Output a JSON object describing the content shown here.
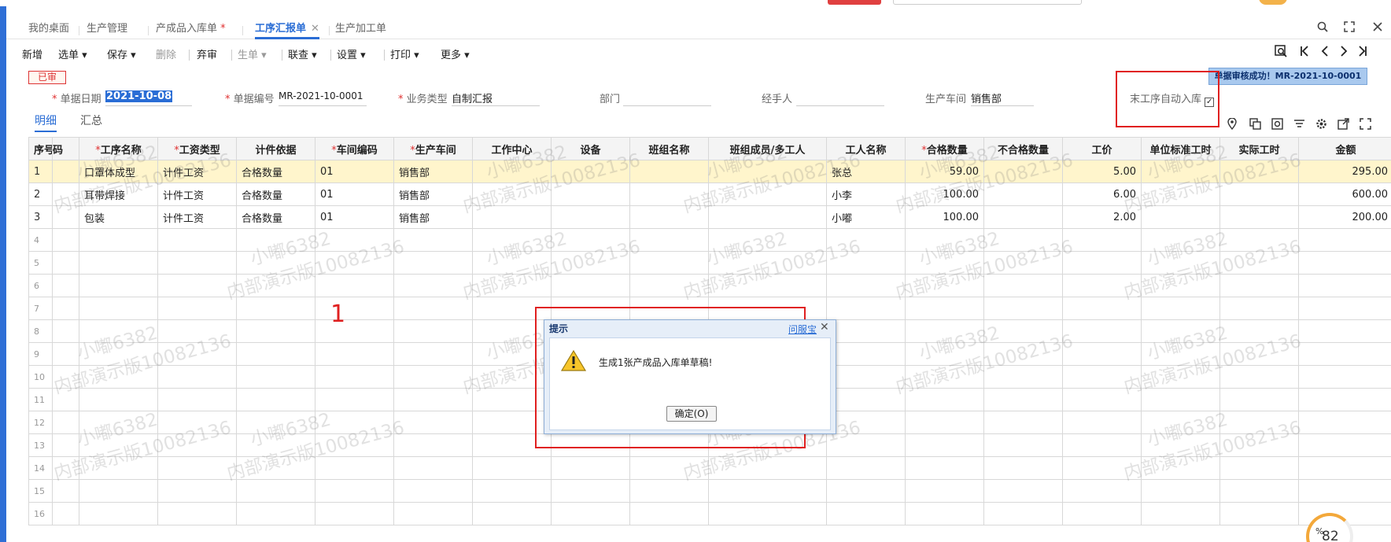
{
  "tabs": [
    {
      "label": "我的桌面",
      "active": false,
      "dirty": false
    },
    {
      "label": "生产管理",
      "active": false,
      "dirty": false
    },
    {
      "label": "产成品入库单",
      "active": false,
      "dirty": true
    },
    {
      "label": "工序汇报单",
      "active": true,
      "dirty": false
    },
    {
      "label": "生产加工单",
      "active": false,
      "dirty": false
    }
  ],
  "dirty_mark": "*",
  "close_mark": "✕",
  "toolbar": {
    "new": "新增",
    "select": "选单",
    "save": "保存",
    "delete": "删除",
    "discard": "弃审",
    "generate": "生单",
    "link": "联查",
    "settings": "设置",
    "print": "打印",
    "more": "更多"
  },
  "status_badge": "已审",
  "toast": "单据审核成功！MR-2021-10-0001",
  "form": {
    "date_label": "单据日期",
    "date_value": "2021-10-08",
    "number_label": "单据编号",
    "number_value": "MR-2021-10-0001",
    "biztype_label": "业务类型",
    "biztype_value": "自制汇报",
    "dept_label": "部门",
    "dept_value": "",
    "handler_label": "经手人",
    "handler_value": "",
    "workshop_label": "生产车间",
    "workshop_value": "销售部",
    "auto_stock_label": "末工序自动入库",
    "auto_stock_checked": true
  },
  "subtabs": {
    "detail": "明细",
    "summary": "汇总"
  },
  "grid": {
    "columns": [
      {
        "label": "序号",
        "req": false
      },
      {
        "label": "码",
        "req": false
      },
      {
        "label": "工序名称",
        "req": true
      },
      {
        "label": "工资类型",
        "req": true
      },
      {
        "label": "计件依据",
        "req": false
      },
      {
        "label": "车间编码",
        "req": true
      },
      {
        "label": "生产车间",
        "req": true
      },
      {
        "label": "工作中心",
        "req": false
      },
      {
        "label": "设备",
        "req": false
      },
      {
        "label": "班组名称",
        "req": false
      },
      {
        "label": "班组成员/多工人",
        "req": false
      },
      {
        "label": "工人名称",
        "req": false
      },
      {
        "label": "合格数量",
        "req": true
      },
      {
        "label": "不合格数量",
        "req": false
      },
      {
        "label": "工价",
        "req": false
      },
      {
        "label": "单位标准工时",
        "req": false
      },
      {
        "label": "实际工时",
        "req": false
      },
      {
        "label": "金额",
        "req": false
      }
    ],
    "rows": [
      [
        "1",
        "",
        "口罩体成型",
        "计件工资",
        "合格数量",
        "01",
        "销售部",
        "",
        "",
        "",
        "",
        "张总",
        "59.00",
        "",
        "5.00",
        "",
        "",
        "295.00"
      ],
      [
        "2",
        "",
        "耳带焊接",
        "计件工资",
        "合格数量",
        "01",
        "销售部",
        "",
        "",
        "",
        "",
        "小李",
        "100.00",
        "",
        "6.00",
        "",
        "",
        "600.00"
      ],
      [
        "3",
        "",
        "包装",
        "计件工资",
        "合格数量",
        "01",
        "销售部",
        "",
        "",
        "",
        "",
        "小嘟",
        "100.00",
        "",
        "2.00",
        "",
        "",
        "200.00"
      ]
    ],
    "empty_rows": [
      "4",
      "5",
      "6",
      "7",
      "8",
      "9",
      "10",
      "11",
      "12",
      "13",
      "14",
      "15",
      "16"
    ]
  },
  "watermark": {
    "line1": "小嘟6382",
    "line2": "内部演示版10082136"
  },
  "annotation_number": "1",
  "dialog": {
    "title": "提示",
    "help": "问服宝",
    "message": "生成1张产成品入库单草稿!",
    "ok": "确定(O)"
  },
  "progress": {
    "value": "82",
    "unit": "%"
  },
  "colors": {
    "accent": "#2a6dd5",
    "required": "#e03030",
    "annotation": "#e02020",
    "selected_row": "#fff5cc"
  }
}
